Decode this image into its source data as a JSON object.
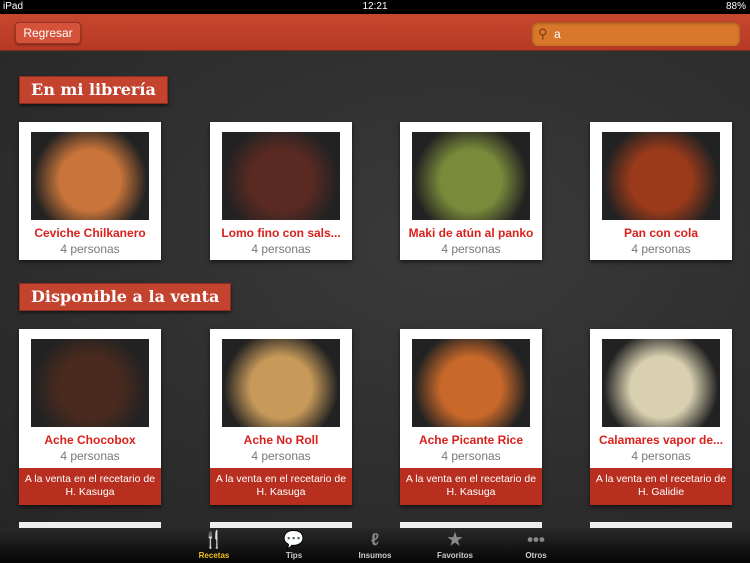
{
  "status": {
    "device": "iPad",
    "time": "12:21",
    "battery": "88%"
  },
  "nav": {
    "back_label": "Regresar",
    "search_value": "a"
  },
  "sections": [
    {
      "title": "En mi librería",
      "items": [
        {
          "title": "Ceviche Chilkanero",
          "servings": "4 personas",
          "color": "#c8743a"
        },
        {
          "title": "Lomo fino con sals...",
          "servings": "4 personas",
          "color": "#5a2a22"
        },
        {
          "title": "Maki de atún al panko",
          "servings": "4 personas",
          "color": "#7a8a3a"
        },
        {
          "title": "Pan con cola",
          "servings": "4 personas",
          "color": "#9a3a1a"
        }
      ]
    },
    {
      "title": "Disponible a la venta",
      "items": [
        {
          "title": "Ache Chocobox",
          "servings": "4 personas",
          "sale": "A la venta en el recetario de H. Kasuga",
          "color": "#4a2a1e"
        },
        {
          "title": "Ache No Roll",
          "servings": "4 personas",
          "sale": "A la venta en el recetario de H. Kasuga",
          "color": "#c89a5a"
        },
        {
          "title": "Ache Picante Rice",
          "servings": "4 personas",
          "sale": "A la venta en el recetario de H. Kasuga",
          "color": "#c8682a"
        },
        {
          "title": "Calamares vapor de...",
          "servings": "4 personas",
          "sale": "A la venta en el recetario de H. Galidie",
          "color": "#d8d0b0"
        }
      ]
    }
  ],
  "tabs": [
    {
      "label": "Recetas",
      "icon": "fork-knife-icon",
      "active": true
    },
    {
      "label": "Tips",
      "icon": "speech-bubbles-icon"
    },
    {
      "label": "Insumos",
      "icon": "chili-pepper-icon"
    },
    {
      "label": "Favoritos",
      "icon": "star-icon"
    },
    {
      "label": "Otros",
      "icon": "more-dots-icon"
    }
  ]
}
